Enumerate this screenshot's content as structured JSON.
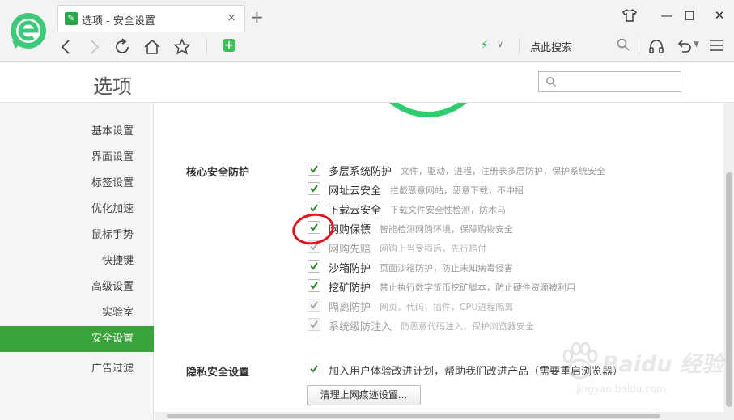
{
  "tab": {
    "title": "选项 - 安全设置",
    "close": "×"
  },
  "toolbar": {
    "new_tab": "+",
    "search_engine": "点此搜索"
  },
  "window_buttons": {
    "minimize": "—",
    "close": "✕"
  },
  "header": {
    "title": "选项",
    "search_placeholder": ""
  },
  "sidebar": {
    "items": [
      {
        "label": "基本设置"
      },
      {
        "label": "界面设置"
      },
      {
        "label": "标签设置"
      },
      {
        "label": "优化加速"
      },
      {
        "label": "鼠标手势"
      },
      {
        "label": "快捷键"
      },
      {
        "label": "高级设置"
      },
      {
        "label": "实验室"
      },
      {
        "label": "安全设置",
        "active": true
      },
      {
        "label": "广告过滤"
      }
    ]
  },
  "core": {
    "title": "核心安全防护",
    "options": [
      {
        "name": "多层系统防护",
        "desc": "文件，驱动，进程，注册表多层防护，保护系统安全",
        "checked": true,
        "disabled": false
      },
      {
        "name": "网址云安全",
        "desc": "拦截恶意网站，恶意下载，不中招",
        "checked": true,
        "disabled": false
      },
      {
        "name": "下载云安全",
        "desc": "下载文件安全性检测，防木马",
        "checked": true,
        "disabled": false
      },
      {
        "name": "网购保镖",
        "desc": "智能检测网购环境，保障购物安全",
        "checked": true,
        "disabled": false
      },
      {
        "name": "网购先赔",
        "desc": "网购上当受损后，先行赔付",
        "checked": true,
        "disabled": true
      },
      {
        "name": "沙箱防护",
        "desc": "页面沙箱防护，防止未知病毒侵害",
        "checked": true,
        "disabled": false
      },
      {
        "name": "挖矿防护",
        "desc": "禁止执行数字货币挖矿脚本，防止硬件资源被利用",
        "checked": true,
        "disabled": false
      },
      {
        "name": "隔离防护",
        "desc": "网页，代码，插件，CPU进程隔离",
        "checked": true,
        "disabled": true
      },
      {
        "name": "系统级防注入",
        "desc": "防恶意代码注入，保护浏览器安全",
        "checked": true,
        "disabled": true
      }
    ]
  },
  "privacy": {
    "title": "隐私安全设置",
    "option": "加入用户体验改进计划，帮助我们改进产品（需要重启浏览器）",
    "clear_button": "清理上网痕迹设置..."
  },
  "watermark": {
    "main": "Baidu 经验",
    "sub": "jingyan.baidu.com"
  },
  "colors": {
    "accent_green": "#3aa43a",
    "annotation_red": "#e0141c",
    "ring_green": "#2ecc71"
  }
}
